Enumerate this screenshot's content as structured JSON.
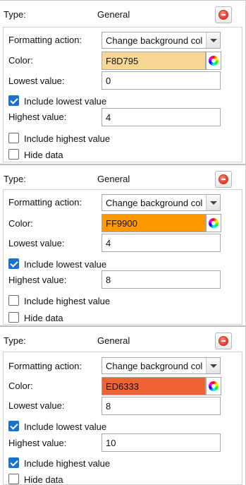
{
  "labels": {
    "type": "Type:",
    "formatting_action": "Formatting action:",
    "color": "Color:",
    "lowest_value": "Lowest value:",
    "include_lowest": "Include lowest value",
    "highest_value": "Highest value:",
    "include_highest": "Include highest value",
    "hide_data": "Hide data"
  },
  "icons": {
    "delete": "delete-circle-icon",
    "color_picker": "color-wheel-icon",
    "dropdown": "chevron-down-icon"
  },
  "rules": [
    {
      "type": "General",
      "formatting_action": "Change background col",
      "color": "F8D795",
      "color_hex": "#F8D795",
      "lowest_value": "0",
      "include_lowest": true,
      "highest_value": "4",
      "include_highest": false,
      "hide_data": false
    },
    {
      "type": "General",
      "formatting_action": "Change background col",
      "color": "FF9900",
      "color_hex": "#FF9900",
      "lowest_value": "4",
      "include_lowest": true,
      "highest_value": "8",
      "include_highest": false,
      "hide_data": false
    },
    {
      "type": "General",
      "formatting_action": "Change background col",
      "color": "ED6333",
      "color_hex": "#ED6333",
      "lowest_value": "8",
      "include_lowest": true,
      "highest_value": "10",
      "include_highest": true,
      "hide_data": false
    }
  ]
}
